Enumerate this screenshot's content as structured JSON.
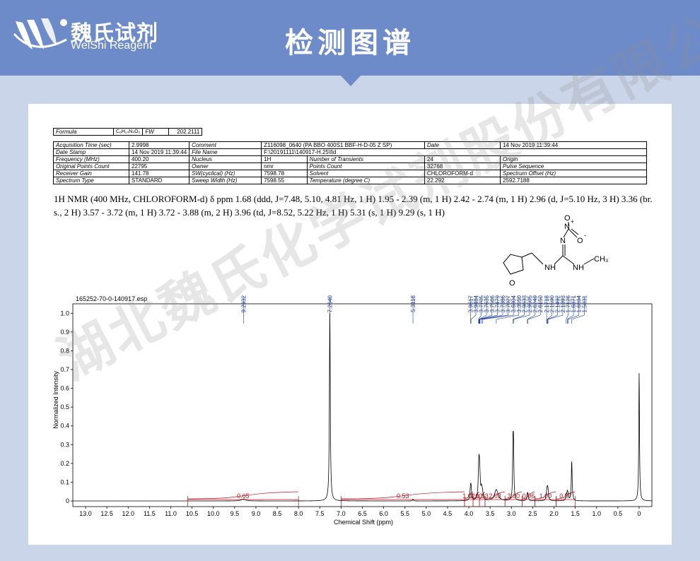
{
  "header": {
    "brand_cn": "魏氏试剂",
    "brand_en": "WeiShi Reagent",
    "title": "检测图谱",
    "colors": {
      "header": "#6e8bc9",
      "background": "#cbd5ea"
    }
  },
  "params": {
    "formula_label": "Formula",
    "formula_value": "C₆H₁₄N₄O₃",
    "fw_label": "FW",
    "fw_value": "202.2111",
    "rows": [
      [
        "Acquisition Time (sec)",
        "2.9998",
        "Comment",
        "Z116098_0640 (PA BBO 400S1 BBF-H-D-05 Z SP)",
        "Date",
        "14 Nov 2019 11:39:44"
      ],
      [
        "Date Stamp",
        "14 Nov 2019 11:39:44",
        "File Name",
        "F:\\20191111\\140917-H.25\\fid",
        "",
        ""
      ],
      [
        "Frequency (MHz)",
        "400.20",
        "Nucleus",
        "1H",
        "Number of Transients",
        "24"
      ],
      [
        "Original Points Count",
        "22795",
        "Owner",
        "nmr",
        "Points Count",
        "32768"
      ],
      [
        "Receiver Gain",
        "141.78",
        "SW(cyclical) (Hz)",
        "7598.78",
        "Solvent",
        "CHLOROFORM-d"
      ],
      [
        "Spectrum Type",
        "STANDARD",
        "Sweep Width (Hz)",
        "7598.55",
        "Temperature (degree C)",
        "22.292"
      ]
    ],
    "rows_right": [
      [
        "Date",
        "14 Nov 2019 11:39:44"
      ],
      [
        "Origin",
        "spect"
      ],
      [
        "Pulse Sequence",
        "zg30"
      ],
      [
        "Spectrum Offset (Hz)",
        "2592.7188"
      ]
    ]
  },
  "nmr_text": "1H NMR (400 MHz, CHLOROFORM-d) δ ppm 1.68 (ddd, J=7.48, 5.10, 4.81 Hz, 1 H) 1.95 - 2.39 (m, 1 H) 2.42 - 2.74 (m, 1 H) 2.96 (d, J=5.10 Hz, 3 H) 3.36 (br. s., 2 H) 3.57 - 3.72 (m, 1 H) 3.72 - 3.88 (m, 2 H) 3.96 (td, J=8.52, 5.22 Hz, 1 H) 5.31 (s, 1 H) 9.29 (s, 1 H)",
  "structure_labels": {
    "o_top": "O",
    "n_nitro": "N",
    "o_minus": "O",
    "n_imine": "N",
    "nh_left": "NH",
    "nh_right": "NH",
    "ch3": "CH₃",
    "ring_o": "O",
    "plus": "+",
    "minus": "-"
  },
  "watermark": "湖北魏氏化学试剂股份有限公司",
  "chart_data": {
    "type": "line",
    "file_label": "165252-70-0-140917.esp",
    "xlabel": "Chemical Shift (ppm)",
    "ylabel": "Normalized Intensity",
    "xlim": [
      13.3,
      -0.3
    ],
    "ylim": [
      -0.03,
      1.05
    ],
    "x_ticks": [
      13.0,
      12.5,
      12.0,
      11.5,
      11.0,
      10.5,
      10.0,
      9.5,
      9.0,
      8.5,
      8.0,
      7.5,
      7.0,
      6.5,
      6.0,
      5.5,
      5.0,
      4.5,
      4.0,
      3.5,
      3.0,
      2.5,
      2.0,
      1.5,
      1.0,
      0.5,
      0
    ],
    "x_tick_labels": [
      "13.0",
      "12.5",
      "12.0",
      "11.5",
      "11.0",
      "10.5",
      "10.0",
      "9.5",
      "9.0",
      "8.5",
      "8.0",
      "7.5",
      "7.0",
      "6.5",
      "6.0",
      "5.5",
      "5.0",
      "4.5",
      "4.0",
      "3.5",
      "3.0",
      "2.5",
      "2.0",
      "1.5",
      "1.0",
      "0.5",
      "0"
    ],
    "y_ticks": [
      0,
      0.1,
      0.2,
      0.3,
      0.4,
      0.5,
      0.6,
      0.7,
      0.8,
      0.9,
      1.0
    ],
    "y_tick_labels": [
      "0",
      "0.1",
      "0.2",
      "0.3",
      "0.4",
      "0.5",
      "0.6",
      "0.7",
      "0.8",
      "0.9",
      "1.0"
    ],
    "peaks": [
      {
        "x": 9.2932,
        "h": 0.01,
        "w": 0.06
      },
      {
        "x": 7.264,
        "h": 1.0,
        "w": 0.012
      },
      {
        "x": 5.3118,
        "h": 0.01,
        "w": 0.01
      },
      {
        "x": 3.9617,
        "h": 0.05,
        "w": 0.015
      },
      {
        "x": 3.9484,
        "h": 0.06,
        "w": 0.015
      },
      {
        "x": 3.7705,
        "h": 0.07,
        "w": 0.015
      },
      {
        "x": 3.7635,
        "h": 0.07,
        "w": 0.015
      },
      {
        "x": 3.7566,
        "h": 0.08,
        "w": 0.015
      },
      {
        "x": 3.7479,
        "h": 0.06,
        "w": 0.015
      },
      {
        "x": 3.7386,
        "h": 0.05,
        "w": 0.015
      },
      {
        "x": 3.7027,
        "h": 0.05,
        "w": 0.015
      },
      {
        "x": 3.6804,
        "h": 0.04,
        "w": 0.015
      },
      {
        "x": 3.355,
        "h": 0.06,
        "w": 0.05
      },
      {
        "x": 2.9633,
        "h": 0.26,
        "w": 0.01
      },
      {
        "x": 2.9505,
        "h": 0.26,
        "w": 0.01
      },
      {
        "x": 2.6249,
        "h": 0.025,
        "w": 0.015
      },
      {
        "x": 2.615,
        "h": 0.025,
        "w": 0.015
      },
      {
        "x": 2.1718,
        "h": 0.03,
        "w": 0.015
      },
      {
        "x": 2.159,
        "h": 0.03,
        "w": 0.015
      },
      {
        "x": 2.1492,
        "h": 0.03,
        "w": 0.015
      },
      {
        "x": 2.1393,
        "h": 0.03,
        "w": 0.015
      },
      {
        "x": 1.7126,
        "h": 0.03,
        "w": 0.012
      },
      {
        "x": 1.6871,
        "h": 0.04,
        "w": 0.012
      },
      {
        "x": 1.6694,
        "h": 0.03,
        "w": 0.012
      },
      {
        "x": 1.5831,
        "h": 0.21,
        "w": 0.012
      },
      {
        "x": 0.0,
        "h": 0.68,
        "w": 0.01
      }
    ],
    "peak_labels": [
      {
        "x": 9.2932,
        "label": "9.2932"
      },
      {
        "x": 7.264,
        "label": "7.2640"
      },
      {
        "x": 5.3118,
        "label": "5.3118"
      },
      {
        "x": 3.9617,
        "label": "3.9617"
      },
      {
        "x": 3.9484,
        "label": "3.9484"
      },
      {
        "x": 3.7705,
        "label": "3.7705"
      },
      {
        "x": 3.7635,
        "label": "3.7635"
      },
      {
        "x": 3.7566,
        "label": "3.7566"
      },
      {
        "x": 3.7479,
        "label": "3.7479"
      },
      {
        "x": 3.7386,
        "label": "3.7386"
      },
      {
        "x": 3.7027,
        "label": "3.7027"
      },
      {
        "x": 3.6804,
        "label": "3.6804"
      },
      {
        "x": 3.355,
        "label": "3.3550"
      },
      {
        "x": 2.9633,
        "label": "2.9633"
      },
      {
        "x": 2.9505,
        "label": "2.9505"
      },
      {
        "x": 2.6249,
        "label": "2.6249"
      },
      {
        "x": 2.615,
        "label": "2.6150"
      },
      {
        "x": 2.1718,
        "label": "2.1718"
      },
      {
        "x": 2.159,
        "label": "2.1590"
      },
      {
        "x": 2.1492,
        "label": "2.1492"
      },
      {
        "x": 2.1393,
        "label": "2.1393"
      },
      {
        "x": 1.7126,
        "label": "1.7126"
      },
      {
        "x": 1.6871,
        "label": "1.6871"
      },
      {
        "x": 1.6694,
        "label": "1.6694"
      },
      {
        "x": 1.5831,
        "label": "1.5831"
      }
    ],
    "integrals": [
      {
        "from": 10.6,
        "to": 8.0,
        "value": "0.65"
      },
      {
        "from": 7.0,
        "to": 4.1,
        "value": "0.53"
      },
      {
        "from": 4.1,
        "to": 3.9,
        "value": "1.02"
      },
      {
        "from": 3.9,
        "to": 3.75,
        "value": "2.00"
      },
      {
        "from": 3.75,
        "to": 3.62,
        "value": "1.03"
      },
      {
        "from": 3.62,
        "to": 3.15,
        "value": "2.03"
      },
      {
        "from": 3.15,
        "to": 2.75,
        "value": "3.00"
      },
      {
        "from": 2.75,
        "to": 2.45,
        "value": "0.96"
      },
      {
        "from": 2.45,
        "to": 1.95,
        "value": "1.00"
      },
      {
        "from": 1.95,
        "to": 1.5,
        "value": "0.97"
      }
    ],
    "colors": {
      "spectrum": "#000000",
      "peak_labels": "#1a3aa0",
      "integrals": "#c0141e"
    }
  }
}
